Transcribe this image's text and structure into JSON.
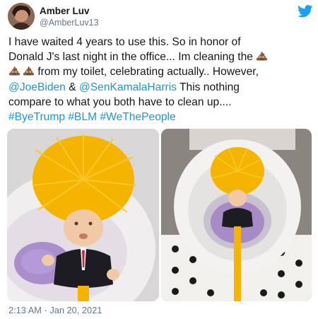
{
  "author": {
    "display_name": "Amber Luv",
    "handle": "@AmberLuv13",
    "avatar_icon": "profile-avatar",
    "platform_icon": "twitter-bird-icon"
  },
  "tweet": {
    "line1": "I have waited 4 years to use this. So in honor of",
    "line2_text": "Donald J's last night in the office... Im cleaning the ",
    "line3_text": " from my toilet, celebrating actually.. However,",
    "line4_mention1": "@JoeBiden",
    "line4_amp": " & ",
    "line4_mention2": "@SenKamalaHarris",
    "line4_rest": " This nothing",
    "line5": "compare to what you both have to clean up....",
    "hashtags": [
      "#ByeTrump",
      "#BLM",
      "#WeThePeople"
    ],
    "emoji_name": "pile-of-poo-emoji"
  },
  "photos": {
    "left_label": "toilet-brush-photo-closeup",
    "right_label": "toilet-brush-photo-in-toilet"
  },
  "footer": {
    "timestamp": "2:13 AM · Jan 20, 2021"
  },
  "colors": {
    "link": "#1b95e0",
    "secondary_text": "#657786",
    "twitter_blue": "#1da1f2",
    "brush_yellow": "#f7b500"
  }
}
